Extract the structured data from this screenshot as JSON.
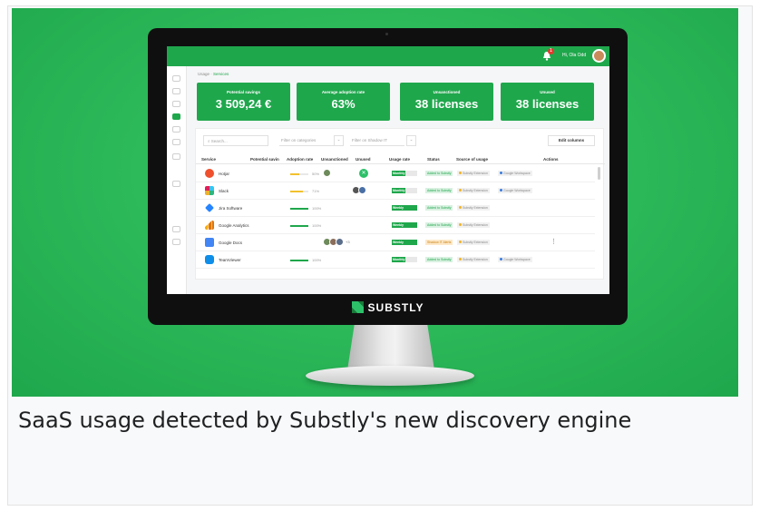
{
  "caption": "SaaS usage detected by Substly's new discovery engine",
  "brand": {
    "name": "SUBSTLY",
    "accent": "#1fa74c"
  },
  "header": {
    "user": "Hi, Ola Odd",
    "notifications": "1",
    "bell_icon": "bell-icon"
  },
  "breadcrumb": {
    "root": "Usage",
    "sep": " · ",
    "current": "Services"
  },
  "kpis": [
    {
      "title": "Potential savings",
      "value": "3 509,24 €"
    },
    {
      "title": "Average adoption rate",
      "value": "63%"
    },
    {
      "title": "Unsanctioned",
      "value": "38 licenses"
    },
    {
      "title": "Unused",
      "value": "38 licenses"
    }
  ],
  "toolbar": {
    "search_placeholder": "Search...",
    "filter_categories": "Filter on categories",
    "filter_shadow": "Filter on Shadow IT",
    "edit_columns": "Edit columns"
  },
  "table": {
    "headers": [
      "Service",
      "Potential savin",
      "Adoption rate",
      "Unsanctioned",
      "Unused",
      "Usage rate",
      "Status",
      "Source of usage",
      "Actions"
    ],
    "rows": [
      {
        "name": "Hotjar",
        "adoption": 0.5,
        "adoption_label": "50%",
        "usage": "Monthly",
        "usage_fill": 0.55,
        "status": "Added to Substly",
        "sources": [
          "Substly Extension",
          "Google Workspace"
        ]
      },
      {
        "name": "Slack",
        "adoption": 0.7,
        "adoption_label": "71%",
        "usage": "Monthly",
        "usage_fill": 0.55,
        "status": "Added to Substly",
        "sources": [
          "Substly Extension",
          "Google Workspace"
        ]
      },
      {
        "name": "Jira Software",
        "adoption": 1.0,
        "adoption_label": "100%",
        "usage": "Weekly",
        "usage_fill": 1.0,
        "status": "Added to Substly",
        "sources": [
          "Substly Extension"
        ]
      },
      {
        "name": "Google Analytics",
        "adoption": 1.0,
        "adoption_label": "100%",
        "usage": "Weekly",
        "usage_fill": 1.0,
        "status": "Added to Substly",
        "sources": [
          "Substly Extension"
        ]
      },
      {
        "name": "Google Docs",
        "adoption": 0,
        "adoption_label": "",
        "more": "+3",
        "usage": "Weekly",
        "usage_fill": 1.0,
        "status": "Shadow IT Alerts",
        "sources": [
          "Substly Extension"
        ]
      },
      {
        "name": "TeamViewer",
        "adoption": 1.0,
        "adoption_label": "100%",
        "usage": "Monthly",
        "usage_fill": 0.55,
        "status": "Added to Substly",
        "sources": [
          "Substly Extension",
          "Google Workspace"
        ]
      }
    ]
  },
  "colors": {
    "status_added_bg": "#d9f1e1",
    "status_added_fg": "#1fa74c",
    "status_shadow_bg": "#fde8c8",
    "status_shadow_fg": "#c98212",
    "src_extension_dot": "#f0b429",
    "src_google_dot": "#3b7ddd"
  }
}
